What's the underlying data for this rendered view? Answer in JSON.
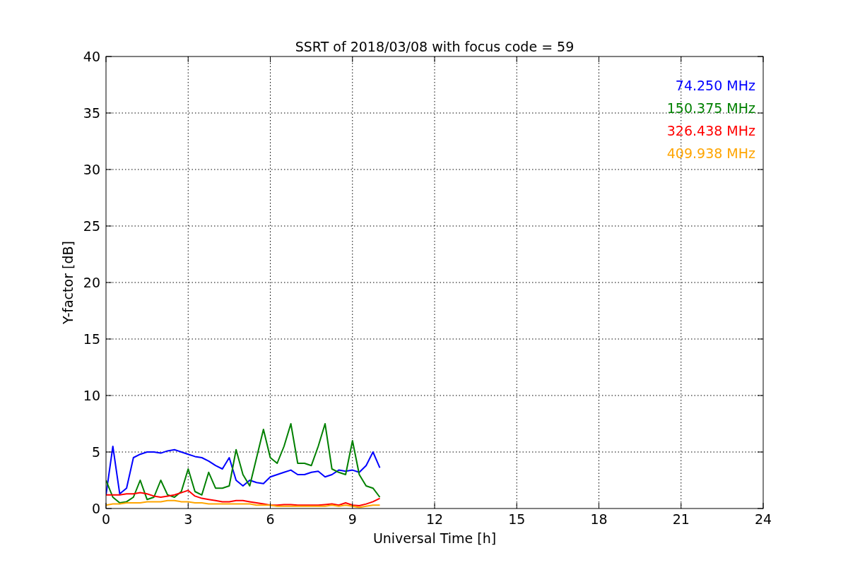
{
  "figure": {
    "chart_data": {
      "type": "line",
      "title": "SSRT of 2018/03/08 with focus code = 59",
      "xlabel": "Universal Time [h]",
      "ylabel": "Y-factor [dB]",
      "x": [
        0,
        0.25,
        0.5,
        0.75,
        1,
        1.25,
        1.5,
        1.75,
        2,
        2.25,
        2.5,
        2.75,
        3,
        3.25,
        3.5,
        3.75,
        4,
        4.25,
        4.5,
        4.75,
        5,
        5.25,
        5.5,
        5.75,
        6,
        6.25,
        6.5,
        6.75,
        7,
        7.25,
        7.5,
        7.75,
        8,
        8.25,
        8.5,
        8.75,
        9,
        9.25,
        9.5,
        9.75,
        10
      ],
      "series": [
        {
          "name": "74.250 MHz",
          "color": "#0000ff",
          "values": [
            1.2,
            5.5,
            1.3,
            1.8,
            4.5,
            4.8,
            5,
            5,
            4.9,
            5.1,
            5.2,
            5,
            4.8,
            4.6,
            4.5,
            4.2,
            3.8,
            3.5,
            4.5,
            2.5,
            2,
            2.5,
            2.3,
            2.2,
            2.8,
            3,
            3.2,
            3.4,
            3,
            3,
            3.2,
            3.3,
            2.8,
            3,
            3.4,
            3.3,
            3.4,
            3.2,
            3.8,
            5,
            3.6
          ]
        },
        {
          "name": "150.375 MHz",
          "color": "#008000",
          "values": [
            2.5,
            1,
            0.5,
            0.6,
            1,
            2.5,
            0.8,
            1,
            2.5,
            1.2,
            1,
            1.5,
            3.5,
            1.5,
            1.2,
            3.2,
            1.8,
            1.8,
            2,
            5.2,
            3,
            2,
            4.5,
            7,
            4.5,
            4,
            5.5,
            7.5,
            4,
            4,
            3.8,
            5.5,
            7.5,
            3.5,
            3.2,
            3,
            6,
            3,
            2,
            1.8,
            1
          ]
        },
        {
          "name": "326.438 MHz",
          "color": "#ff0000",
          "values": [
            1.2,
            1.2,
            1.2,
            1.3,
            1.3,
            1.4,
            1.3,
            1.1,
            1,
            1.1,
            1.2,
            1.4,
            1.6,
            1.1,
            0.9,
            0.8,
            0.7,
            0.6,
            0.6,
            0.7,
            0.7,
            0.6,
            0.5,
            0.4,
            0.3,
            0.3,
            0.35,
            0.35,
            0.3,
            0.3,
            0.3,
            0.3,
            0.35,
            0.4,
            0.3,
            0.5,
            0.3,
            0.25,
            0.4,
            0.6,
            0.9
          ]
        },
        {
          "name": "409.938 MHz",
          "color": "#ffa500",
          "values": [
            0.3,
            0.4,
            0.4,
            0.5,
            0.5,
            0.5,
            0.6,
            0.6,
            0.6,
            0.7,
            0.7,
            0.6,
            0.6,
            0.5,
            0.5,
            0.4,
            0.4,
            0.4,
            0.4,
            0.4,
            0.4,
            0.4,
            0.3,
            0.3,
            0.3,
            0.2,
            0.2,
            0.2,
            0.2,
            0.2,
            0.2,
            0.2,
            0.2,
            0.3,
            0.2,
            0.3,
            0.2,
            0.1,
            0.2,
            0.3,
            0.3
          ]
        }
      ],
      "grid": true,
      "xlim": [
        0,
        24
      ],
      "ylim": [
        0,
        40
      ],
      "xticks": [
        0,
        3,
        6,
        9,
        12,
        15,
        18,
        21,
        24
      ],
      "yticks": [
        0,
        5,
        10,
        15,
        20,
        25,
        30,
        35,
        40
      ]
    }
  }
}
